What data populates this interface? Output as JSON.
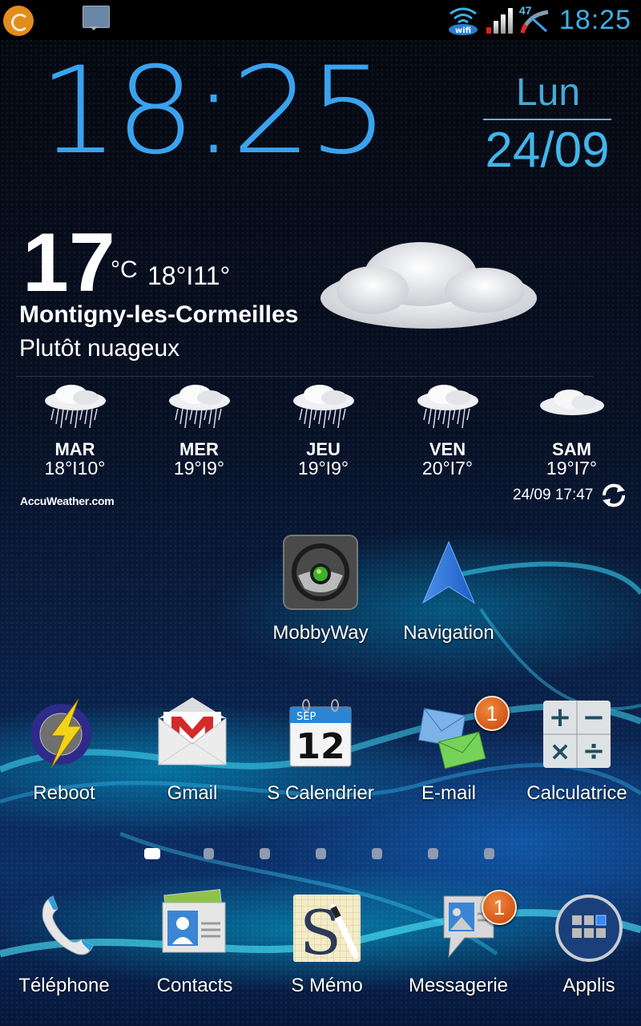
{
  "status_bar": {
    "left_icons": [
      "avast-icon",
      "message-notification-icon"
    ],
    "right_icons": [
      "wifi-icon",
      "signal-icon",
      "battery-gauge-icon"
    ],
    "battery_level": "47",
    "time": "18:25"
  },
  "clock_widget": {
    "time": "18:25",
    "day": "Lun",
    "date": "24/09"
  },
  "weather_widget": {
    "current_temp": "17",
    "unit": "°C",
    "high_low": "18°I11°",
    "location": "Montigny-les-Cormeilles",
    "condition": "Plutôt nuageux",
    "condition_icon": "cloud-icon",
    "forecast": [
      {
        "day": "MAR",
        "temps": "18°I10°",
        "icon": "rain-cloud-icon"
      },
      {
        "day": "MER",
        "temps": "19°I9°",
        "icon": "rain-cloud-icon"
      },
      {
        "day": "JEU",
        "temps": "19°I9°",
        "icon": "rain-cloud-icon"
      },
      {
        "day": "VEN",
        "temps": "20°I7°",
        "icon": "rain-cloud-icon"
      },
      {
        "day": "SAM",
        "temps": "19°I7°",
        "icon": "cloud-icon"
      }
    ],
    "provider_bold": "AccuWeather",
    "provider_suffix": ".com",
    "updated": "24/09 17:47"
  },
  "home_apps_row1": [
    {
      "label": "MobbyWay",
      "icon": "mobbyway-icon"
    },
    {
      "label": "Navigation",
      "icon": "navigation-arrow-icon"
    }
  ],
  "home_apps_row2": [
    {
      "label": "Reboot",
      "icon": "reboot-lightning-icon"
    },
    {
      "label": "Gmail",
      "icon": "gmail-icon"
    },
    {
      "label": "S Calendrier",
      "icon": "calendar-icon",
      "month": "SEP",
      "day": "12"
    },
    {
      "label": "E-mail",
      "icon": "email-icon",
      "badge": "1"
    },
    {
      "label": "Calculatrice",
      "icon": "calculator-icon"
    }
  ],
  "page_indicator": {
    "total": 7,
    "active": 1
  },
  "dock": [
    {
      "label": "Téléphone",
      "icon": "phone-icon"
    },
    {
      "label": "Contacts",
      "icon": "contacts-icon"
    },
    {
      "label": "S Mémo",
      "icon": "s-memo-icon"
    },
    {
      "label": "Messagerie",
      "icon": "messaging-icon",
      "badge": "1"
    },
    {
      "label": "Applis",
      "icon": "app-drawer-icon"
    }
  ]
}
